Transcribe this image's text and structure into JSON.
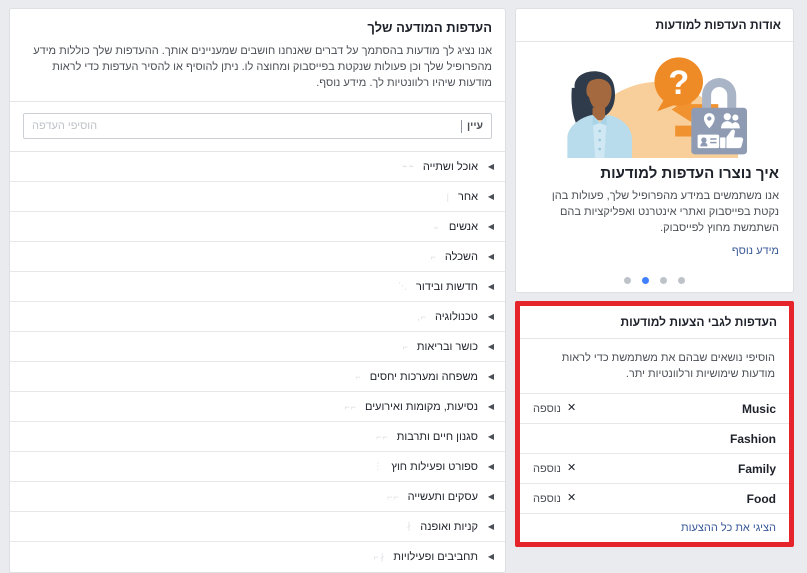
{
  "main": {
    "title": "העדפות המודעה שלך",
    "description": "אנו נציג לך מודעות בהסתמך על דברים שאנחנו חושבים שמעניינים אותך. ההעדפות שלך כוללות מידע מהפרופיל שלך וכן פעולות שנקטת בפייסבוק ומחוצה לו. ניתן להוסיף או להסיר העדפות כדי לראות מודעות שיהיו רלוונטיות לך. מידע נוסף.",
    "search": {
      "placeholder": "הוסיפי העדפה",
      "browse_label": "עיין"
    },
    "categories": [
      {
        "label": "אוכל ושתייה",
        "glyph": "⌁⌁"
      },
      {
        "label": "אחר",
        "glyph": "|"
      },
      {
        "label": "אנשים",
        "glyph": "⌄"
      },
      {
        "label": "השכלה",
        "glyph": "⌐"
      },
      {
        "label": "חדשות ובידור",
        "glyph": "⋰"
      },
      {
        "label": "טכנולוגיה",
        "glyph": "⌐,"
      },
      {
        "label": "כושר ובריאות",
        "glyph": "⌐"
      },
      {
        "label": "משפחה ומערכות יחסים",
        "glyph": "⌐"
      },
      {
        "label": "נסיעות, מקומות ואירועים",
        "glyph": "⌐⌐"
      },
      {
        "label": "סגנון חיים ותרבות",
        "glyph": "⌐⌐"
      },
      {
        "label": "ספורט ופעילות חוץ",
        "glyph": "⋮"
      },
      {
        "label": "עסקים ותעשייה",
        "glyph": "⌐⌐"
      },
      {
        "label": "קניות ואופנה",
        "glyph": "∤"
      },
      {
        "label": "תחביבים ופעילויות",
        "glyph": "∤⌐"
      }
    ]
  },
  "sidebar": {
    "about": {
      "header": "אודות העדפות למודעות",
      "heading": "איך נוצרו העדפות למודעות",
      "paragraph": "אנו משתמשים במידע מהפרופיל שלך, פעולות בהן נקטת בפייסבוק ואתרי אינטרנט ואפליקציות בהם השתמשת מחוץ לפייסבוק.",
      "link": "מידע נוסף",
      "dots_total": 4,
      "dots_active_index": 2
    },
    "suggestions": {
      "header": "העדפות לגבי הצעות למודעות",
      "description": "הוסיפי נושאים שבהם את משתמשת כדי לראות מודעות שימושיות ורלוונטיות יתר.",
      "added_label": "נוספה",
      "close_icon": "✕",
      "items": [
        {
          "name": "Music",
          "added": true
        },
        {
          "name": "Fashion",
          "added": false
        },
        {
          "name": "Family",
          "added": true
        },
        {
          "name": "Food",
          "added": true
        }
      ],
      "footer_link": "הציגי את כל ההצעות"
    }
  },
  "colors": {
    "highlight_border": "#e5252b",
    "link": "#385898",
    "dot_active": "#4080ff",
    "page_background": "#e9ebee"
  }
}
